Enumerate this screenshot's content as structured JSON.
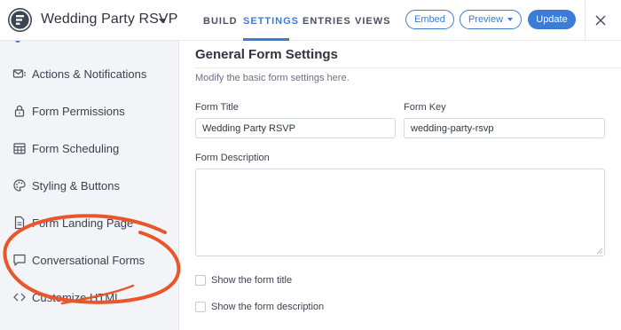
{
  "header": {
    "form_name": "Wedding Party RSVP",
    "tabs": [
      {
        "label": "BUILD"
      },
      {
        "label": "SETTINGS"
      },
      {
        "label": "ENTRIES"
      },
      {
        "label": "VIEWS"
      }
    ],
    "active_tab": "SETTINGS",
    "embed_label": "Embed",
    "preview_label": "Preview",
    "update_label": "Update"
  },
  "sidebar": {
    "items": [
      {
        "label": "Actions & Notifications",
        "icon": "notification-envelope-icon"
      },
      {
        "label": "Form Permissions",
        "icon": "lock-icon"
      },
      {
        "label": "Form Scheduling",
        "icon": "calendar-icon"
      },
      {
        "label": "Styling & Buttons",
        "icon": "palette-icon"
      },
      {
        "label": "Form Landing Page",
        "icon": "document-icon"
      },
      {
        "label": "Conversational Forms",
        "icon": "chat-bubble-icon"
      },
      {
        "label": "Customize HTML",
        "icon": "code-icon"
      }
    ]
  },
  "main": {
    "heading": "General Form Settings",
    "description": "Modify the basic form settings here.",
    "form_title_label": "Form Title",
    "form_title_value": "Wedding Party RSVP",
    "form_key_label": "Form Key",
    "form_key_value": "wedding-party-rsvp",
    "form_description_label": "Form Description",
    "form_description_value": "",
    "show_title_label": "Show the form title",
    "show_title_checked": false,
    "show_description_label": "Show the form description",
    "show_description_checked": false
  },
  "colors": {
    "accent": "#3a7cd6",
    "annotation": "#e8562a",
    "sidebar_bg": "#f3f4f7"
  }
}
